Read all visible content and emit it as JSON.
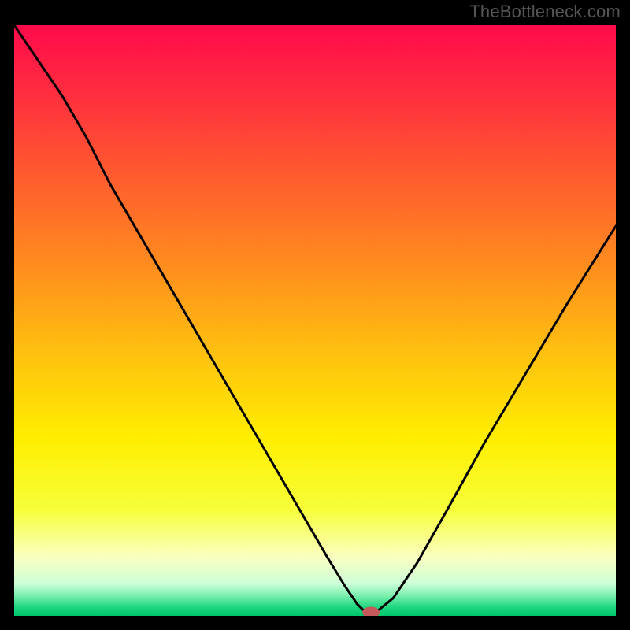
{
  "attribution": "TheBottleneck.com",
  "chart_data": {
    "type": "line",
    "title": "",
    "xlabel": "",
    "ylabel": "",
    "xlim": [
      0,
      100
    ],
    "ylim": [
      0,
      100
    ],
    "grid": false,
    "legend": false,
    "background": {
      "type": "vertical-gradient",
      "stops": [
        {
          "pos": 0.0,
          "color": "#ff0a4a"
        },
        {
          "pos": 0.12,
          "color": "#ff2f3f"
        },
        {
          "pos": 0.25,
          "color": "#ff5a2f"
        },
        {
          "pos": 0.4,
          "color": "#ff8a1f"
        },
        {
          "pos": 0.55,
          "color": "#ffbf10"
        },
        {
          "pos": 0.7,
          "color": "#ffee00"
        },
        {
          "pos": 0.82,
          "color": "#f7ff3a"
        },
        {
          "pos": 0.9,
          "color": "#faffc0"
        },
        {
          "pos": 0.945,
          "color": "#ceffd8"
        },
        {
          "pos": 0.965,
          "color": "#7ff0b0"
        },
        {
          "pos": 0.985,
          "color": "#1fd780"
        },
        {
          "pos": 1.0,
          "color": "#00c56a"
        }
      ]
    },
    "series": [
      {
        "name": "curve",
        "stroke": "#000000",
        "strokeWidth": 3,
        "x": [
          0,
          4,
          8,
          12,
          16,
          20,
          24,
          28,
          32,
          36,
          40,
          44,
          48,
          52,
          55,
          57,
          58.5,
          60,
          63,
          67,
          72,
          78,
          85,
          92,
          100
        ],
        "y": [
          100,
          94,
          88,
          81,
          73,
          66,
          59,
          52,
          45,
          38,
          31,
          24,
          17,
          10,
          5,
          2,
          0.5,
          0.5,
          3,
          9,
          18,
          29,
          41,
          53,
          66
        ]
      }
    ],
    "marker": {
      "name": "bottleneck-marker",
      "x": 59.3,
      "y": 0.6,
      "rx": 11,
      "ry": 7,
      "fill": "#c65a5a"
    },
    "axes_ticks": {
      "x": [],
      "y": []
    }
  }
}
